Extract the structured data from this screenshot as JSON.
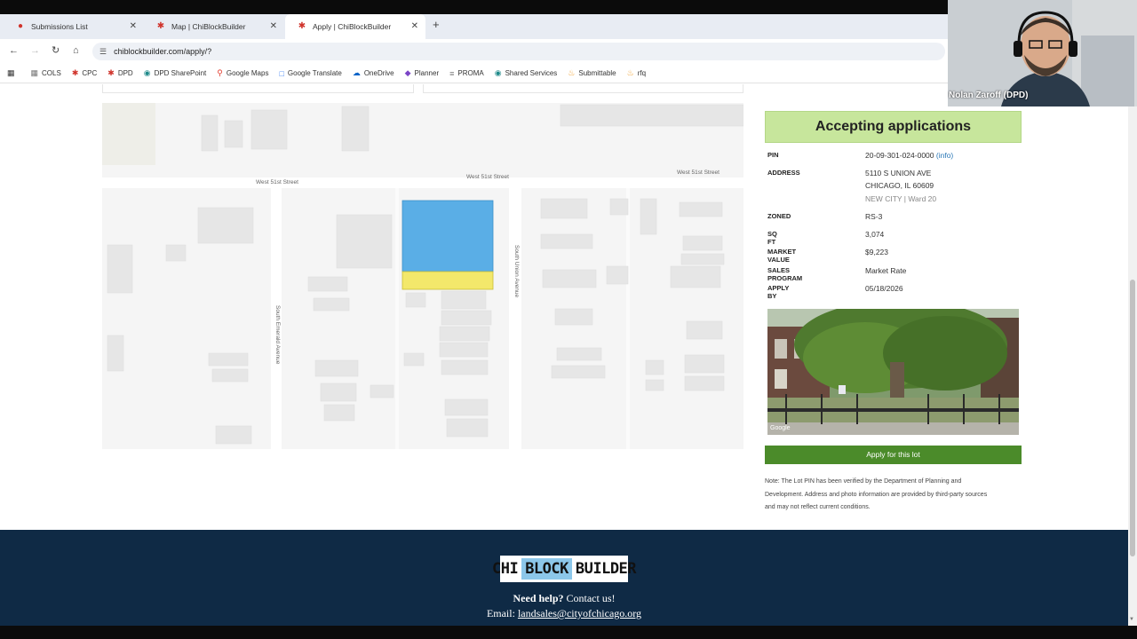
{
  "browser": {
    "tabs": [
      {
        "title": "Submissions List",
        "active": false
      },
      {
        "title": "Map | ChiBlockBuilder",
        "active": false
      },
      {
        "title": "Apply | ChiBlockBuilder",
        "active": true
      }
    ],
    "url": "chiblockbuilder.com/apply/?",
    "bookmarks": [
      "COLS",
      "CPC",
      "DPD",
      "DPD SharePoint",
      "Google Maps",
      "Google Translate",
      "OneDrive",
      "Planner",
      "PROMA",
      "Shared Services",
      "Submittable",
      "rfq"
    ]
  },
  "map": {
    "street_labels": [
      "West 51st Street",
      "West 51st Street",
      "West 51st Street",
      "South Emerald Avenue",
      "South Union Avenue"
    ],
    "colors": {
      "parcel_blue": "#5aaee6",
      "parcel_yellow": "#f3e86b"
    }
  },
  "lot": {
    "status": "Accepting applications",
    "fields": {
      "pin_label": "PIN",
      "pin_value": "20-09-301-024-0000",
      "pin_info": "(info)",
      "address_label": "ADDRESS",
      "address_line1": "5110 S UNION AVE",
      "address_line2": "CHICAGO, IL 60609",
      "address_area": "NEW CITY | Ward 20",
      "zoned_label": "ZONED",
      "zoned_value": "RS-3",
      "sqft_label": "SQ FT",
      "sqft_value": "3,074",
      "market_label": "MARKET VALUE",
      "market_value": "$9,223",
      "program_label": "SALES PROGRAM",
      "program_value": "Market Rate",
      "apply_label": "APPLY BY",
      "apply_value": "05/18/2026"
    },
    "photo_credit": "Google",
    "apply_button": "Apply for this lot",
    "note_lines": [
      "Note: The Lot PIN has been verified by the Department of Planning and",
      "Development. Address and photo information are provided by third-party sources",
      "and may not reflect current conditions."
    ]
  },
  "footer": {
    "logo": [
      "CHI",
      "BLOCK",
      "BUILDER"
    ],
    "help_bold": "Need help?",
    "help_rest": " Contact us!",
    "email_label": "Email: ",
    "email": "landsales@cityofchicago.org"
  },
  "webcam": {
    "name": "Nolan Zaroff (DPD)"
  }
}
